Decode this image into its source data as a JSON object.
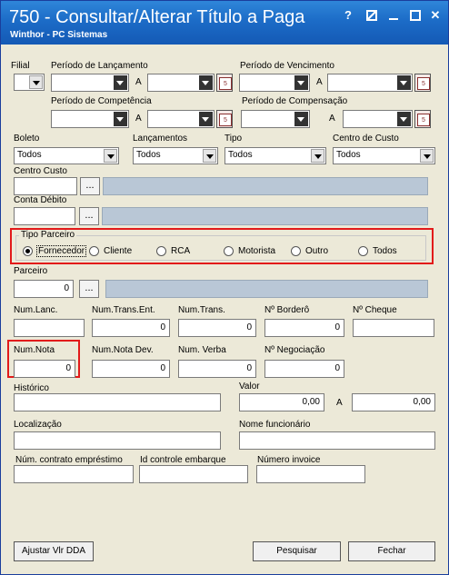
{
  "window": {
    "title": "750 - Consultar/Alterar Título a Paga",
    "subtitle": "Winthor - PC Sistemas",
    "help_label": "?",
    "close_label": "✕"
  },
  "filters": {
    "filial": "Filial",
    "periodo_lancamento": "Período de Lançamento",
    "periodo_vencimento": "Período de Vencimento",
    "periodo_competencia": "Período de Competência",
    "periodo_compensacao": "Período de Compensação",
    "a": "A",
    "cal_day": "5"
  },
  "combos": {
    "boleto": {
      "label": "Boleto",
      "value": "Todos"
    },
    "lancamentos": {
      "label": "Lançamentos",
      "value": "Todos"
    },
    "tipo": {
      "label": "Tipo",
      "value": "Todos"
    },
    "centro_custo": {
      "label": "Centro de Custo",
      "value": "Todos"
    }
  },
  "centro_custo": {
    "label": "Centro Custo",
    "button": "..."
  },
  "conta_debito": {
    "label": "Conta Débito",
    "button": "..."
  },
  "tipo_parceiro": {
    "label": "Tipo Parceiro",
    "options": [
      "Fornecedor",
      "Cliente",
      "RCA",
      "Motorista",
      "Outro",
      "Todos"
    ],
    "selected": "Fornecedor"
  },
  "parceiro": {
    "label": "Parceiro",
    "value": "0",
    "button": "..."
  },
  "row1": {
    "num_lanc": {
      "label": "Num.Lanc.",
      "value": ""
    },
    "num_trans_ent": {
      "label": "Num.Trans.Ent.",
      "value": "0"
    },
    "num_trans": {
      "label": "Num.Trans.",
      "value": "0"
    },
    "num_bordero": {
      "label": "Nº Borderô",
      "value": "0"
    },
    "num_cheque": {
      "label": "Nº Cheque",
      "value": ""
    }
  },
  "row2": {
    "num_nota": {
      "label": "Num.Nota",
      "value": "0"
    },
    "num_nota_dev": {
      "label": "Num.Nota Dev.",
      "value": "0"
    },
    "num_verba": {
      "label": "Num. Verba",
      "value": "0"
    },
    "num_negociacao": {
      "label": "Nº Negociação",
      "value": "0"
    }
  },
  "historico": {
    "label": "Histórico",
    "value": ""
  },
  "valor": {
    "label": "Valor",
    "from": "0,00",
    "a": "A",
    "to": "0,00"
  },
  "localizacao": {
    "label": "Localização",
    "value": ""
  },
  "nome_funcionario": {
    "label": "Nome funcionário",
    "value": ""
  },
  "contrato": {
    "label": "Núm. contrato empréstimo",
    "value": ""
  },
  "embarque": {
    "label": "Id controle embarque",
    "value": ""
  },
  "invoice": {
    "label": "Número invoice",
    "value": ""
  },
  "buttons": {
    "ajustar": "Ajustar Vlr DDA",
    "pesquisar": "Pesquisar",
    "fechar": "Fechar"
  },
  "colors": {
    "titlebar": "#1c6cc7",
    "highlight": "#e21a1a",
    "readonly": "#b9c7d6"
  }
}
